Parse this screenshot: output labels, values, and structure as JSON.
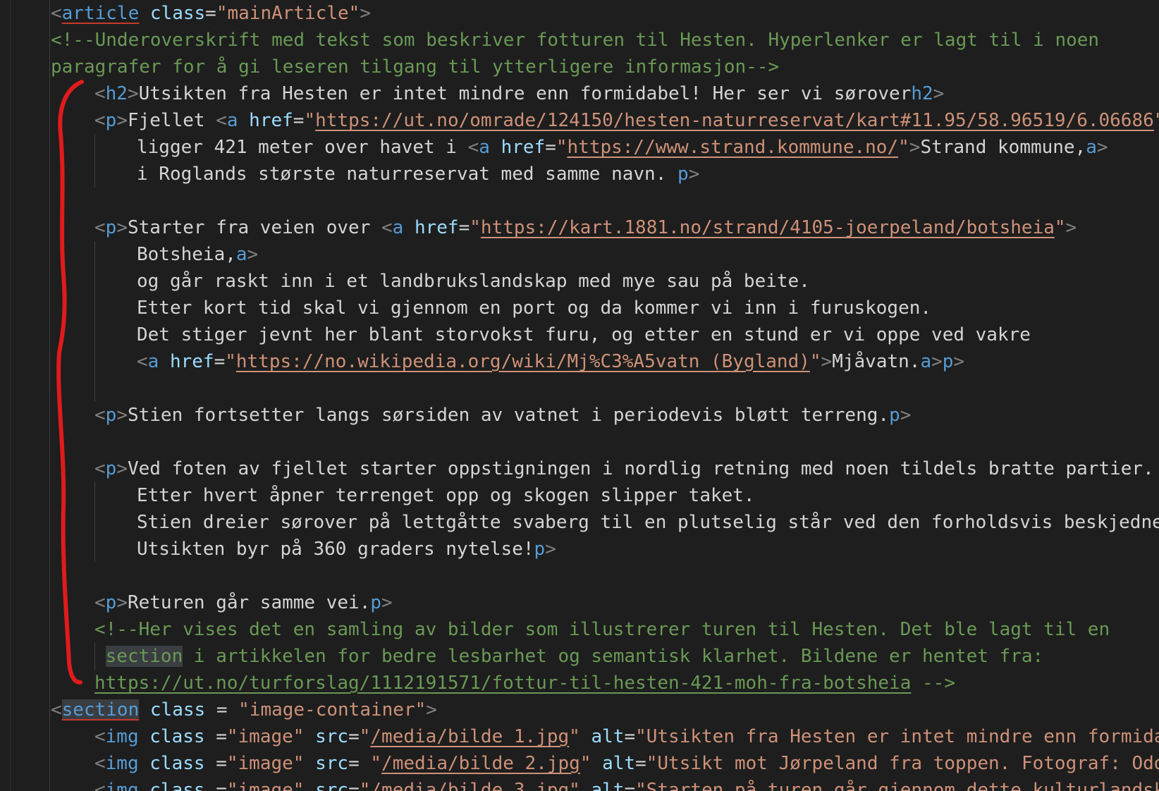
{
  "code": {
    "l1": {
      "tag": "article",
      "attr": "class",
      "val": "\"mainArticle\""
    },
    "l2": {
      "comment": "<!--Underoverskrift med tekst som beskriver fotturen til Hesten. Hyperlenker er lagt til i noen"
    },
    "l3": {
      "comment": "paragrafer for å gi leseren tilgang til ytterligere informasjon-->"
    },
    "l4": {
      "tag": "h2",
      "text": "Utsikten fra Hesten er intet mindre enn formidabel! Her ser vi sørover",
      "close_tag": "h2"
    },
    "l5": {
      "tag": "p",
      "text": "Fjellet ",
      "a_tag": "a",
      "attr": "href",
      "url": "https://ut.no/omrade/124150/hesten-naturreservat/kart#11.95/58.96519/6.06686"
    },
    "l6": {
      "text": "ligger 421 meter over havet i ",
      "a_tag": "a",
      "attr": "href",
      "url": "https://www.strand.kommune.no/",
      "link_text": "Strand kommune,",
      "close_tag": "a"
    },
    "l7": {
      "text": "i Roglands største naturreservat med samme navn. ",
      "close_tag": "p"
    },
    "l8": {
      "tag": "p",
      "text": "Starter fra veien over ",
      "a_tag": "a",
      "attr": "href",
      "url": "https://kart.1881.no/strand/4105-joerpeland/botsheia"
    },
    "l9": {
      "text": "Botsheia,",
      "close_tag": "a"
    },
    "l10": {
      "text": "og går raskt inn i et landbrukslandskap med mye sau på beite."
    },
    "l11": {
      "text": "Etter kort tid skal vi gjennom en port og da kommer vi inn i furuskogen."
    },
    "l12": {
      "text": "Det stiger jevnt her blant storvokst furu, og etter en stund er vi oppe ved vakre"
    },
    "l13": {
      "a_tag": "a",
      "attr": "href",
      "url": "https://no.wikipedia.org/wiki/Mj%C3%A5vatn_(Bygland)",
      "link_text": "Mjåvatn.",
      "close_a": "a",
      "close_p": "p"
    },
    "l14": {
      "tag": "p",
      "text": "Stien fortsetter langs sørsiden av vatnet i periodevis bløtt terreng.",
      "close_tag": "p"
    },
    "l15": {
      "tag": "p",
      "text": "Ved foten av fjellet starter oppstigningen i nordlig retning med noen tildels bratte partier."
    },
    "l16": {
      "text": "Etter hvert åpner terrenget opp og skogen slipper taket."
    },
    "l17": {
      "text": "Stien dreier sørover på lettgåtte svaberg til en plutselig står ved den forholdsvis beskjedne v"
    },
    "l18": {
      "text": "Utsikten byr på 360 graders nytelse!",
      "close_tag": "p"
    },
    "l19": {
      "tag": "p",
      "text": "Returen går samme vei.",
      "close_tag": "p"
    },
    "l20": {
      "comment": "<!--Her vises det en samling av bilder som illustrerer turen til Hesten. Det ble lagt til en"
    },
    "l21": {
      "word": "section",
      "comment": " i artikkelen for bedre lesbarhet og semantisk klarhet. Bildene er hentet fra:"
    },
    "l22": {
      "url": "https://ut.no/turforslag/1112191571/fottur-til-hesten-421-moh-fra-botsheia",
      "end": " -->"
    },
    "l23": {
      "tag": "section",
      "attr": "class",
      "eq": " = ",
      "val": "\"image-container\""
    },
    "l24": {
      "tag": "img",
      "attr1": "class",
      "eq1": " =",
      "val1": "\"image\"",
      "attr2": "src",
      "eq2": "=",
      "q_open": "\"",
      "src": "/media/bilde 1.jpg",
      "q_close": "\"",
      "attr3": "alt",
      "alt": "\"Utsikten fra Hesten er intet mindre enn formidabe"
    },
    "l25": {
      "tag": "img",
      "attr1": "class",
      "eq1": " =",
      "val1": "\"image\"",
      "attr2": "src",
      "eq2": "= ",
      "q_open": "\"",
      "src": "/media/bilde 2.jpg",
      "q_close": "\"",
      "attr3": "alt",
      "alt": "\"Utsikt mot Jørpeland fra toppen. Fotograf: Odd"
    },
    "l26": {
      "tag": "img",
      "attr1": "class",
      "eq1": " =",
      "val1": "\"image\"",
      "attr2": "src",
      "eq2": "=",
      "q_open": "\"",
      "src": "/media/bilde 3.jpg",
      "q_close": "\"",
      "attr3": "alt",
      "alt": "\"Starten på turen går gjennom dette kulturlandska"
    }
  },
  "colors": {
    "background": "#1e1e1e",
    "tag": "#569cd6",
    "attribute": "#9cdcfe",
    "string": "#ce9178",
    "comment": "#6a9955",
    "text": "#d4d4d4",
    "punctuation": "#808080",
    "annotation": "#e01b1b"
  }
}
